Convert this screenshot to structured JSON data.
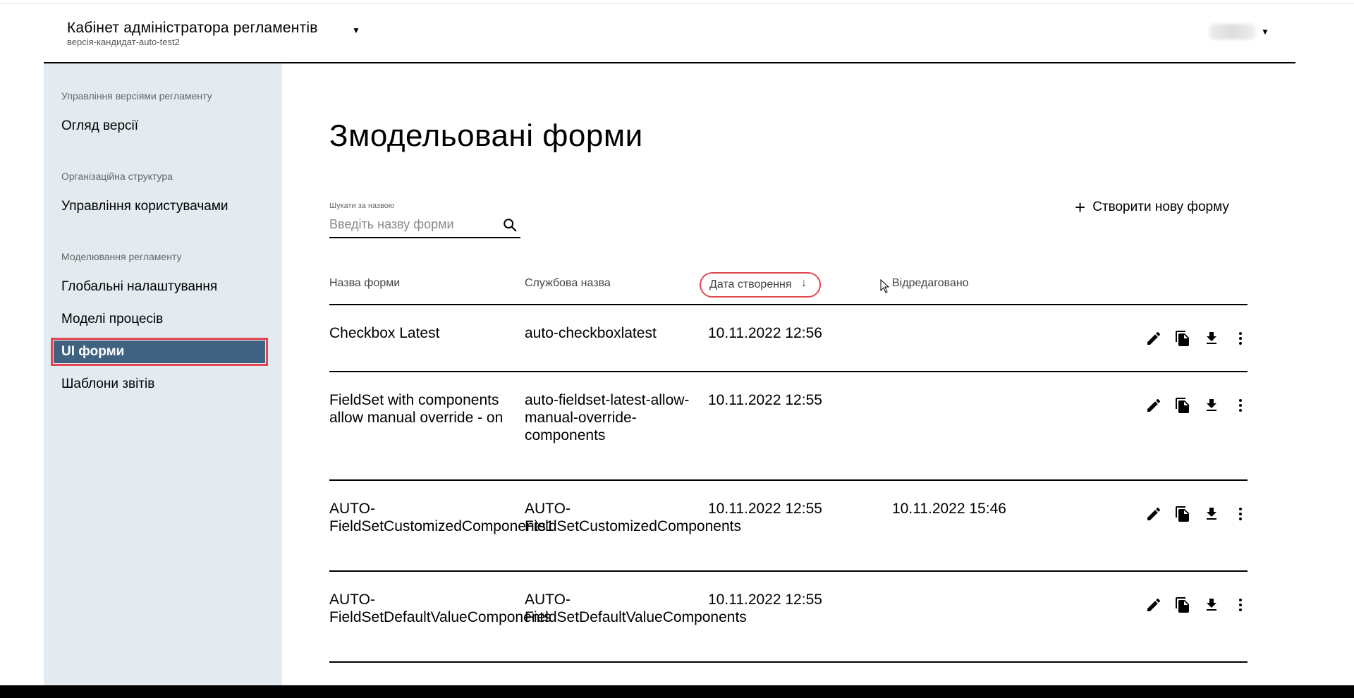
{
  "header": {
    "title": "Кабінет адміністратора регламентів",
    "subtitle": "версія-кандидат-auto-test2"
  },
  "sidebar": {
    "groups": [
      {
        "label": "Управління версіями регламенту",
        "items": [
          "Огляд версії"
        ]
      },
      {
        "label": "Організаційна структура",
        "items": [
          "Управління користувачами"
        ]
      },
      {
        "label": "Моделювання регламенту",
        "items": [
          "Глобальні налаштування",
          "Моделі процесів",
          "UI форми",
          "Шаблони звітів"
        ]
      }
    ],
    "active_item": "UI форми"
  },
  "main": {
    "title": "Змодельовані форми",
    "search": {
      "label": "Шукати за назвою",
      "placeholder": "Введіть назву форми",
      "value": ""
    },
    "create_button_label": "Створити нову форму",
    "table": {
      "headers": {
        "name": "Назва форми",
        "service_name": "Службова назва",
        "created": "Дата створення",
        "edited": "Відредаговано"
      },
      "sorted_by": "created",
      "sort_direction": "descending",
      "rows": [
        {
          "name": "Checkbox Latest",
          "service_name": "auto-checkboxlatest",
          "created": "10.11.2022 12:56",
          "edited": ""
        },
        {
          "name": "FieldSet with components allow manual override - on",
          "service_name": "auto-fieldset-latest-allow-manual-override-components",
          "created": "10.11.2022 12:55",
          "edited": ""
        },
        {
          "name": "AUTO-FieldSetCustomizedComponents1",
          "service_name": "AUTO-FieldSetCustomizedComponents",
          "created": "10.11.2022 12:55",
          "edited": "10.11.2022 15:46"
        },
        {
          "name": "AUTO-FieldSetDefaultValueComponents",
          "service_name": "AUTO-FieldSetDefaultValueComponents",
          "created": "10.11.2022 12:55",
          "edited": ""
        }
      ],
      "row_action_icons": [
        "edit-icon",
        "copy-icon",
        "download-icon",
        "more-vert-icon"
      ]
    }
  },
  "colors": {
    "sidebar_bg": "#e3ebf0",
    "active_item_bg": "#3e6280",
    "highlight_outline": "#e2464f"
  }
}
